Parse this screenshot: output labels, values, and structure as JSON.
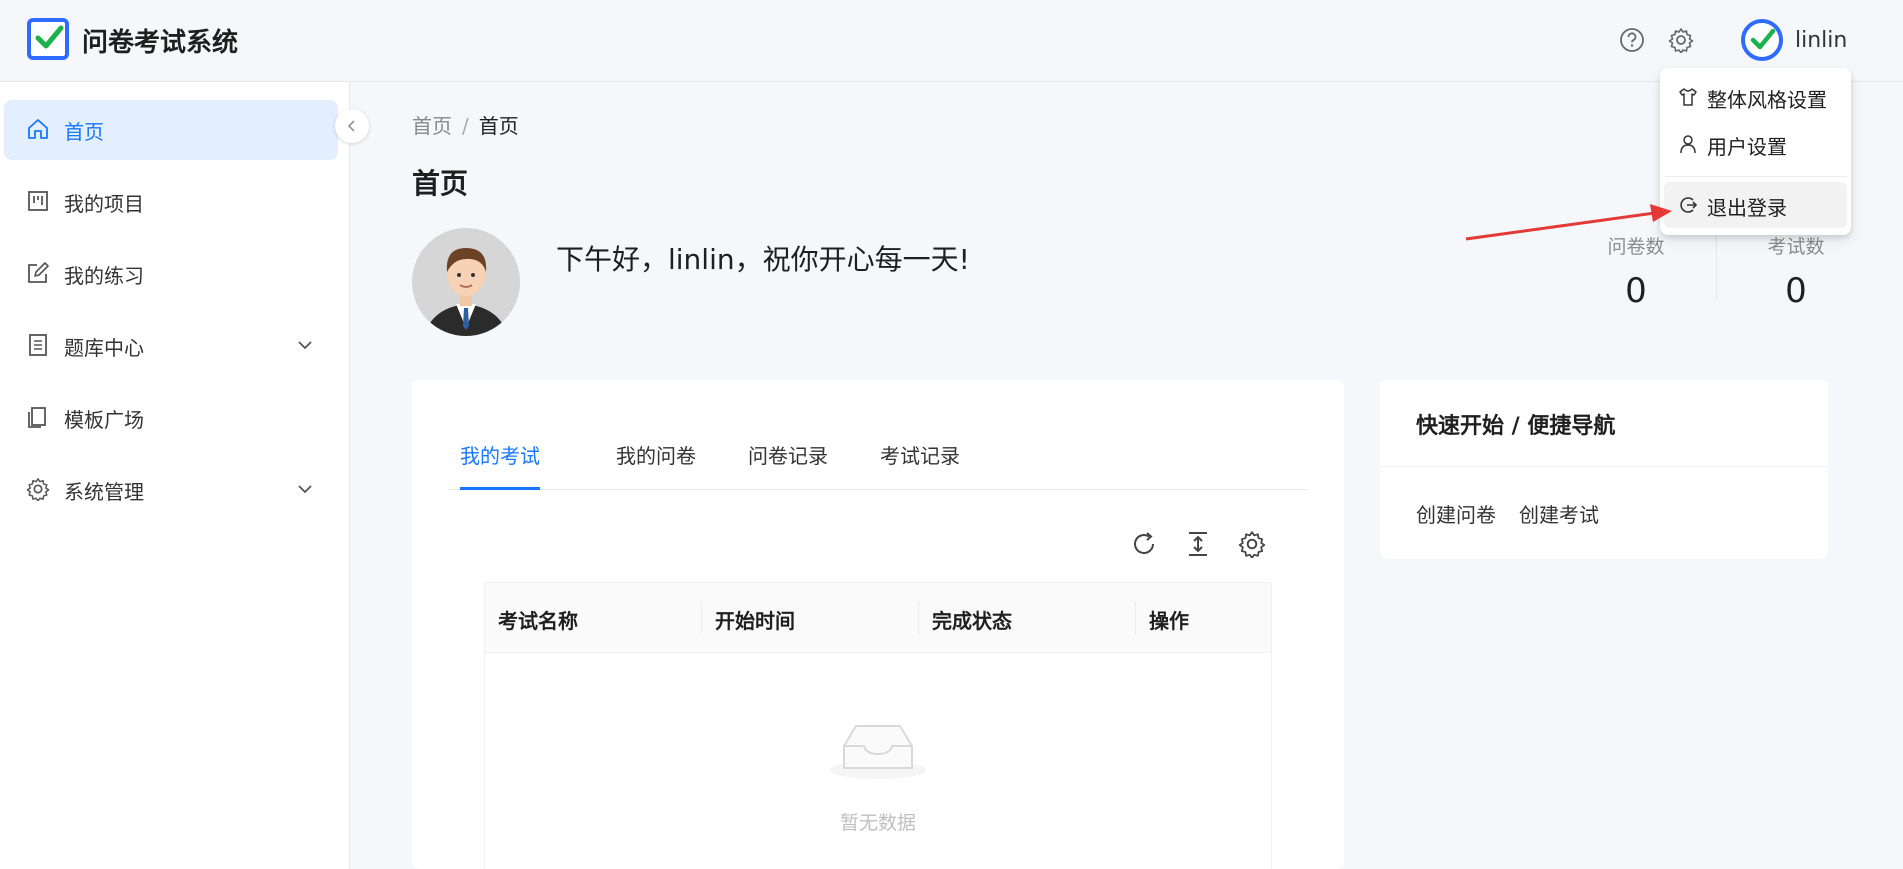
{
  "app": {
    "title": "问卷考试系统",
    "username": "linlin"
  },
  "header": {
    "help_icon": "question-circle-icon",
    "settings_icon": "gear-icon"
  },
  "sidebar": {
    "items": [
      {
        "label": "首页",
        "icon": "home-icon",
        "active": true
      },
      {
        "label": "我的项目",
        "icon": "project-icon"
      },
      {
        "label": "我的练习",
        "icon": "edit-icon"
      },
      {
        "label": "题库中心",
        "icon": "question-bank-icon",
        "expandable": true
      },
      {
        "label": "模板广场",
        "icon": "template-icon"
      },
      {
        "label": "系统管理",
        "icon": "gear-icon",
        "expandable": true
      }
    ]
  },
  "breadcrumb": {
    "root": "首页",
    "sep": "/",
    "current": "首页"
  },
  "page": {
    "title": "首页",
    "greeting": "下午好，linlin，祝你开心每一天!"
  },
  "stats": [
    {
      "label": "问卷数",
      "value": "0"
    },
    {
      "label": "考试数",
      "value": "0"
    }
  ],
  "tabs": [
    "我的考试",
    "我的问卷",
    "问卷记录",
    "考试记录"
  ],
  "table": {
    "columns": [
      "考试名称",
      "开始时间",
      "完成状态",
      "操作"
    ],
    "empty_text": "暂无数据"
  },
  "quick_start": {
    "title": "快速开始 / 便捷导航",
    "links": [
      "创建问卷",
      "创建考试"
    ]
  },
  "user_menu": {
    "items": [
      {
        "label": "整体风格设置",
        "icon": "shirt-icon"
      },
      {
        "label": "用户设置",
        "icon": "user-icon"
      },
      {
        "label": "退出登录",
        "icon": "logout-icon"
      }
    ]
  },
  "colors": {
    "accent": "#1677ff",
    "logo": "#2f6bff",
    "check": "#1cb24a",
    "annotation_arrow": "#e53935"
  }
}
